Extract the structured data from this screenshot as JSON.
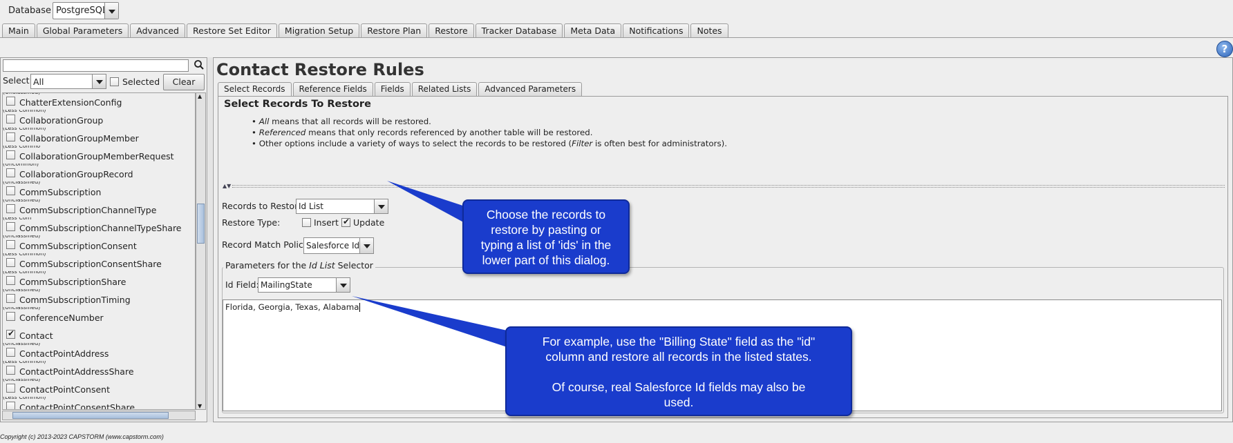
{
  "top": {
    "db_label": "Database",
    "db_value": "PostgreSQL"
  },
  "main_tabs": [
    "Main",
    "Global Parameters",
    "Advanced",
    "Restore Set Editor",
    "Migration Setup",
    "Restore Plan",
    "Restore",
    "Tracker Database",
    "Meta Data",
    "Notifications",
    "Notes"
  ],
  "help": {
    "glyph": "?"
  },
  "left": {
    "search_value": "",
    "select_label": "Select:",
    "select_value": "All",
    "selected_label": "Selected",
    "clear_label": "Clear",
    "objects": [
      {
        "name": "ChatterExtensionConfig",
        "tag": "(Unclassified)",
        "checked": false
      },
      {
        "name": "CollaborationGroup",
        "tag": "(Less Common)",
        "checked": false
      },
      {
        "name": "CollaborationGroupMember",
        "tag": "(Less Common)",
        "checked": false
      },
      {
        "name": "CollaborationGroupMemberRequest",
        "tag": "(Less Commo",
        "checked": false
      },
      {
        "name": "CollaborationGroupRecord",
        "tag": "(Uncommon)",
        "checked": false
      },
      {
        "name": "CommSubscription",
        "tag": "(Unclassified)",
        "checked": false
      },
      {
        "name": "CommSubscriptionChannelType",
        "tag": "(Unclassified)",
        "checked": false
      },
      {
        "name": "CommSubscriptionChannelTypeShare",
        "tag": "(Less Com",
        "checked": false
      },
      {
        "name": "CommSubscriptionConsent",
        "tag": "(Unclassified)",
        "checked": false
      },
      {
        "name": "CommSubscriptionConsentShare",
        "tag": "(Less Common)",
        "checked": false
      },
      {
        "name": "CommSubscriptionShare",
        "tag": "(Less Common)",
        "checked": false
      },
      {
        "name": "CommSubscriptionTiming",
        "tag": "(Unclassified)",
        "checked": false
      },
      {
        "name": "ConferenceNumber",
        "tag": "(Unclassified)",
        "checked": false
      },
      {
        "name": "Contact",
        "tag": "",
        "checked": true
      },
      {
        "name": "ContactPointAddress",
        "tag": "(Unclassified)",
        "checked": false
      },
      {
        "name": "ContactPointAddressShare",
        "tag": "(Less Common)",
        "checked": false
      },
      {
        "name": "ContactPointConsent",
        "tag": "(Unclassified)",
        "checked": false
      },
      {
        "name": "ContactPointConsentShare",
        "tag": "(Less Common)",
        "checked": false
      }
    ]
  },
  "right": {
    "title": "Contact Restore Rules",
    "sub_tabs": [
      "Select Records",
      "Reference Fields",
      "Fields",
      "Related Lists",
      "Advanced Parameters"
    ],
    "section_heading": "Select Records To Restore",
    "bullets": [
      {
        "em": "All",
        "rest": " means that all records will be restored."
      },
      {
        "em": "Referenced",
        "rest": " means that only records referenced by another table will be restored."
      },
      {
        "pre": "Other options include a variety of ways to select the records to be restored (",
        "em": "Filter",
        "rest": " is often best for administrators)."
      }
    ],
    "records_to_restore_label": "Records to Restore:",
    "records_to_restore_value": "Id List",
    "restore_type_label": "Restore Type:",
    "insert_label": "Insert",
    "insert_checked": false,
    "update_label": "Update",
    "update_checked": true,
    "match_policy_label": "Record Match Policy:",
    "match_policy_value": "Salesforce Id",
    "params_legend_pre": "Parameters for the ",
    "params_legend_em": "Id List",
    "params_legend_post": " Selector",
    "id_field_label": "Id Field:",
    "id_field_value": "MailingState",
    "ids_text": "Florida, Georgia, Texas, Alabama"
  },
  "callouts": {
    "first_lines": [
      "Choose the records to",
      "restore by pasting or",
      "typing a list of 'ids' in the",
      "lower part of this dialog."
    ],
    "second_lines": [
      "For example, use the \"Billing State\" field as the \"id\"",
      "column and restore all records in the listed states.",
      "",
      "Of course, real Salesforce Id fields may also be",
      "used."
    ],
    "color": "#1a3ccc"
  },
  "footer": "Copyright (c) 2013-2023 CAPSTORM (www.capstorm.com)"
}
